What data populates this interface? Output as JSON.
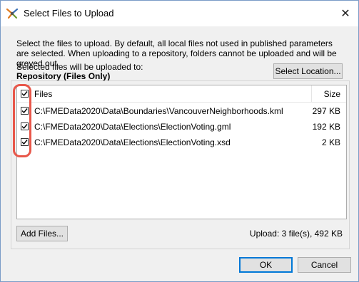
{
  "window": {
    "title": "Select Files to Upload",
    "app_icon": "fme-workbench-icon",
    "close_glyph": "✕"
  },
  "description": "Select the files to upload. By default, all local files not used in published parameters are selected. When uploading to a repository, folders cannot be uploaded and will be greyed out.",
  "destination": {
    "label": "Selected files will be uploaded to:",
    "value": "Repository (Files Only)",
    "select_location_label": "Select Location..."
  },
  "file_list": {
    "header": {
      "files": "Files",
      "size": "Size",
      "all_checked": true
    },
    "rows": [
      {
        "checked": true,
        "path": "C:\\FMEData2020\\Data\\Boundaries\\VancouverNeighborhoods.kml",
        "size": "297 KB"
      },
      {
        "checked": true,
        "path": "C:\\FMEData2020\\Data\\Elections\\ElectionVoting.gml",
        "size": "192 KB"
      },
      {
        "checked": true,
        "path": "C:\\FMEData2020\\Data\\Elections\\ElectionVoting.xsd",
        "size": "2 KB"
      }
    ]
  },
  "footer": {
    "add_files_label": "Add Files...",
    "upload_summary": "Upload: 3 file(s), 492 KB",
    "ok_label": "OK",
    "cancel_label": "Cancel"
  },
  "colors": {
    "highlight": "#e8574a",
    "default_button_border": "#0078d7"
  }
}
